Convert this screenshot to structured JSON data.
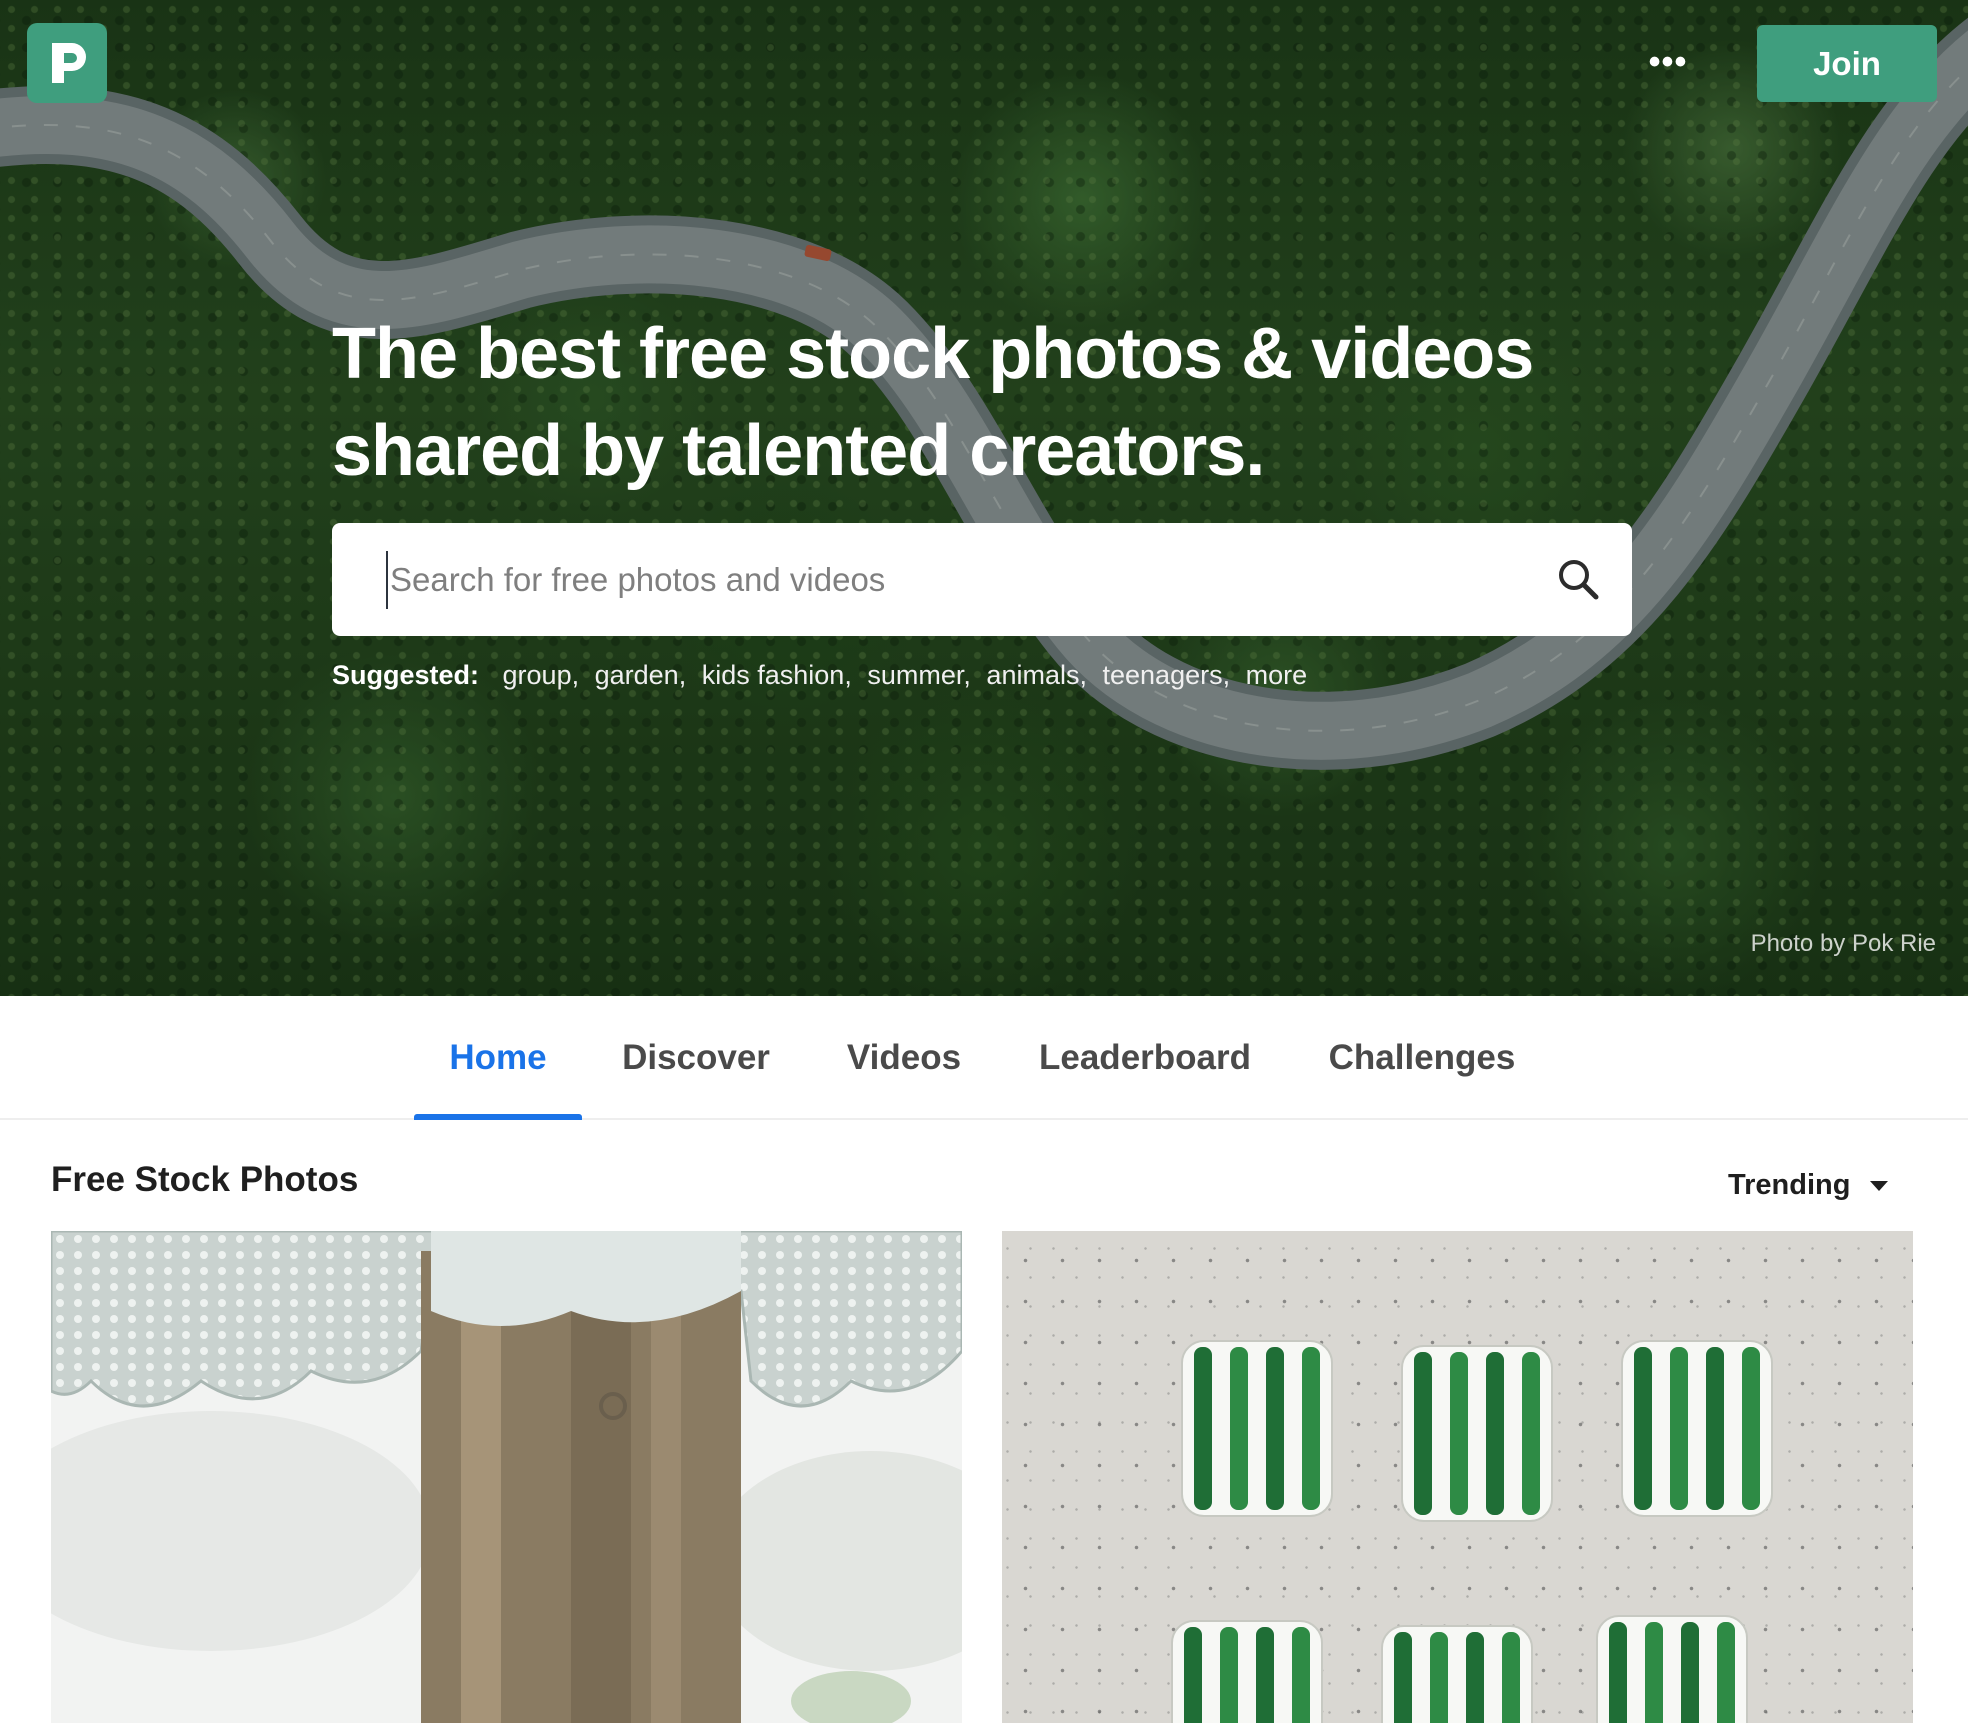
{
  "header": {
    "logo_icon": "pexels-logo-icon",
    "more_icon": "ellipsis-icon",
    "more_label": "•••",
    "join_label": "Join"
  },
  "hero": {
    "title_line1": "The best free stock photos & videos",
    "title_line2": "shared by talented creators.",
    "search": {
      "placeholder": "Search for free photos and videos",
      "value": "",
      "icon": "search-icon"
    },
    "suggested": {
      "label": "Suggested:",
      "items": [
        "group",
        "garden",
        "kids fashion",
        "summer",
        "animals",
        "teenagers",
        "more"
      ]
    },
    "photo_credit": "Photo by Pok Rie"
  },
  "tabs": [
    {
      "label": "Home",
      "active": true
    },
    {
      "label": "Discover",
      "active": false
    },
    {
      "label": "Videos",
      "active": false
    },
    {
      "label": "Leaderboard",
      "active": false
    },
    {
      "label": "Challenges",
      "active": false
    }
  ],
  "section": {
    "title": "Free Stock Photos",
    "sort": {
      "selected": "Trending"
    }
  },
  "colors": {
    "brand": "#3f9e7e",
    "active_tab": "#1a73e8",
    "text": "#1f1f1f",
    "tab_text": "#4a4a4a"
  }
}
